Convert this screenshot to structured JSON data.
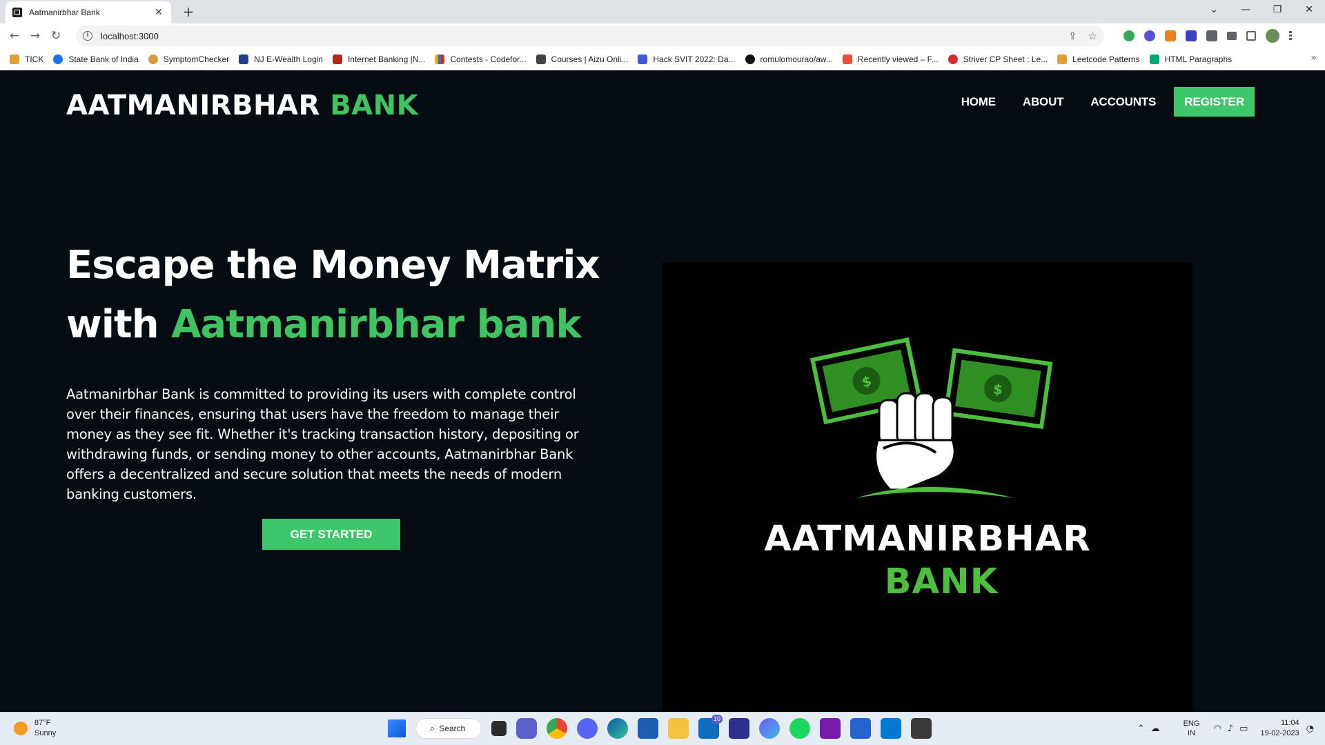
{
  "browser": {
    "tab_title": "Aatmanirbhar Bank",
    "tab_close": "✕",
    "new_tab": "+",
    "url": "localhost:3000",
    "window_controls": [
      "⌄",
      "—",
      "❐",
      "✕"
    ],
    "bookmarks": [
      {
        "label": "TICK",
        "color": "#e0a030"
      },
      {
        "label": "State Bank of India",
        "color": "#1a73e8"
      },
      {
        "label": "SymptomChecker",
        "color": "#d99a3a"
      },
      {
        "label": "NJ E-Wealth Login",
        "color": "#243e8f"
      },
      {
        "label": "Internet Banking |N...",
        "color": "#b3261e"
      },
      {
        "label": "Contests - Codefor...",
        "color": "#2f6fd8"
      },
      {
        "label": "Courses | Aizu Onli...",
        "color": "#444444"
      },
      {
        "label": "Hack SVIT 2022: Da...",
        "color": "#3b5bdb"
      },
      {
        "label": "romulomourao/aw...",
        "color": "#111111"
      },
      {
        "label": "Recently viewed – F...",
        "color": "#e94f37"
      },
      {
        "label": "Striver CP Sheet : Le...",
        "color": "#d32f2f"
      },
      {
        "label": "Leetcode Patterns",
        "color": "#e0a030"
      },
      {
        "label": "HTML Paragraphs",
        "color": "#04aa6d"
      }
    ],
    "bookmarks_more": "»"
  },
  "site": {
    "brand_primary": "AATMANIRBHAR",
    "brand_accent": "BANK",
    "nav": {
      "home": "HOME",
      "about": "ABOUT",
      "accounts": "ACCOUNTS",
      "register": "REGISTER"
    },
    "hero": {
      "title_line1": "Escape the Money Matrix",
      "title_with": "with",
      "title_accent": "Aatmanirbhar bank",
      "description": "Aatmanirbhar Bank is committed to providing its users with complete control over their finances, ensuring that users have the freedom to manage their money as they see fit. Whether it's tracking transaction history, depositing or withdrawing funds, or sending money to other accounts, Aatmanirbhar Bank offers a decentralized and secure solution that meets the needs of modern banking customers.",
      "cta": "GET STARTED"
    },
    "logo": {
      "word1": "AATMANIRBHAR",
      "word2": "BANK"
    },
    "colors": {
      "accent": "#40c463",
      "background": "#050d12"
    }
  },
  "taskbar": {
    "weather_temp": "87°F",
    "weather_desc": "Sunny",
    "search_label": "Search",
    "mail_badge": "10",
    "lang_line1": "ENG",
    "lang_line2": "IN",
    "time": "11:04",
    "date": "19-02-2023"
  }
}
